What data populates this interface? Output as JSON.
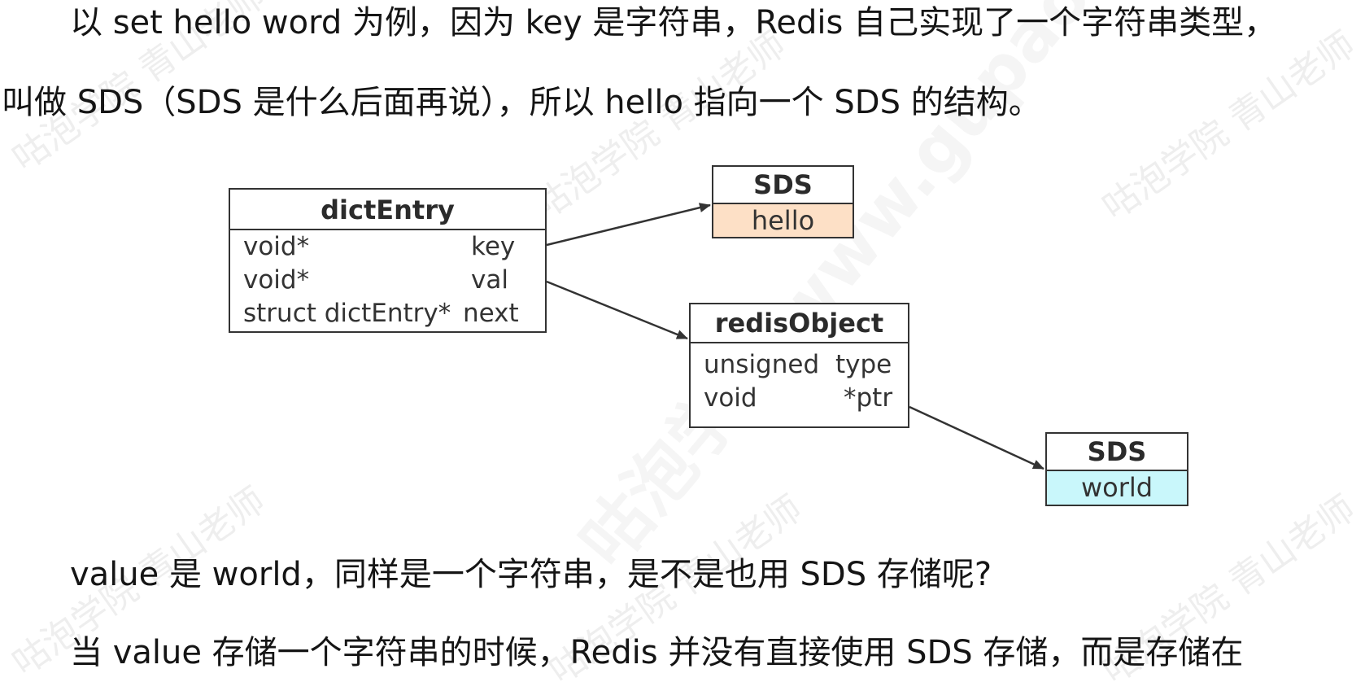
{
  "paragraphs": {
    "p1": "以 set hello word 为例，因为 key 是字符串，Redis 自己实现了一个字符串类型，",
    "p2": "叫做 SDS（SDS 是什么后面再说），所以 hello 指向一个 SDS 的结构。",
    "p3": "value 是 world，同样是一个字符串，是不是也用 SDS 存储呢?",
    "p4": "当 value 存储一个字符串的时候，Redis 并没有直接使用 SDS 存储，而是存储在"
  },
  "watermarks": {
    "text": "咕泡学院 青山老师",
    "big_text": "咕泡学院 www.gupaoedu.com"
  },
  "diagram": {
    "dictEntry": {
      "title": "dictEntry",
      "rows": [
        {
          "type": "void*",
          "name": "key"
        },
        {
          "type": "void*",
          "name": "val"
        },
        {
          "type": "struct dictEntry*",
          "name": "next"
        }
      ]
    },
    "sds_key": {
      "title": "SDS",
      "value": "hello",
      "color": "#fde0c6"
    },
    "redisObject": {
      "title": "redisObject",
      "rows": [
        {
          "type": "unsigned",
          "name": "type"
        },
        {
          "type": "void",
          "name": "*ptr"
        }
      ]
    },
    "sds_value": {
      "title": "SDS",
      "value": "world",
      "color": "#c9f7fb"
    }
  }
}
